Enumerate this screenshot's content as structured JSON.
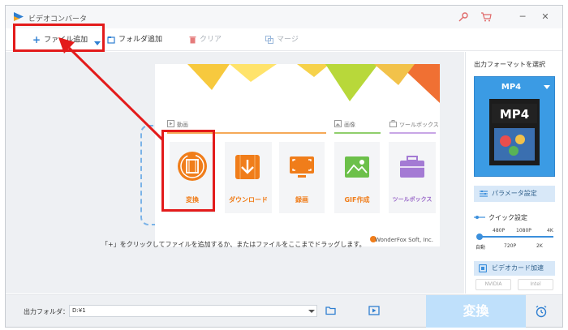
{
  "app": {
    "title": "ビデオコンバータ"
  },
  "toolbar": {
    "add_file": "ファイル追加",
    "add_folder": "フォルダ追加",
    "clear": "クリア",
    "merge": "マージ"
  },
  "launcher": {
    "sections": {
      "video": "動画",
      "image": "画像",
      "toolbox": "ツールボックス"
    },
    "tiles": [
      {
        "label": "変換",
        "color": "#f07d1a"
      },
      {
        "label": "ダウンロード",
        "color": "#f07d1a"
      },
      {
        "label": "録画",
        "color": "#f07d1a"
      },
      {
        "label": "GIF作成",
        "color": "#f07d1a"
      },
      {
        "label": "ツールボックス",
        "color": "#9a6ac9"
      }
    ],
    "brand": "WonderFox Soft, Inc."
  },
  "main": {
    "drop_hint": "「+」をクリックしてファイルを追加するか、またはファイルをここまでドラッグします。"
  },
  "output": {
    "title": "出力フォーマットを選択",
    "format": "MP4",
    "thumb_text": "MP4",
    "param_button": "パラメータ設定",
    "quick_label": "クイック設定",
    "ticks_top": [
      "480P",
      "1080P",
      "4K"
    ],
    "ticks_bottom": [
      "自動",
      "720P",
      "2K"
    ],
    "gpu_button": "ビデオカード加速",
    "chips": [
      "NVIDIA",
      "Intel"
    ]
  },
  "bottom": {
    "folder_label": "出力フォルダ：",
    "folder_value": "D:¥1",
    "convert_button": "変換"
  },
  "colors": {
    "accent": "#3b9be4",
    "annotation": "#e31b1b"
  }
}
